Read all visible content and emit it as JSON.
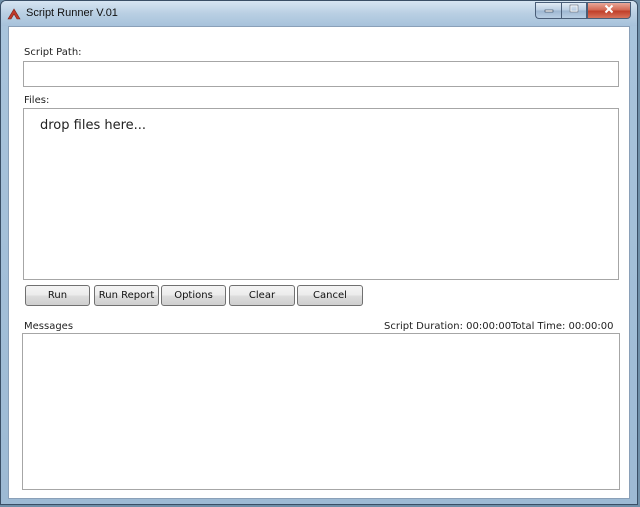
{
  "window": {
    "title": "Script Runner V.01",
    "icons": {
      "app": "app-logo-icon",
      "minimize": "minimize-icon",
      "maximize": "maximize-icon",
      "close": "close-icon"
    }
  },
  "script_path": {
    "label": "Script Path:",
    "value": "",
    "placeholder": ""
  },
  "files": {
    "label": "Files:",
    "drop_hint": "drop files here..."
  },
  "buttons": {
    "run": "Run",
    "run_report": "Run Report",
    "options": "Options",
    "clear": "Clear",
    "cancel": "Cancel"
  },
  "messages": {
    "label": "Messages",
    "script_duration": "Script Duration: 00:00:00",
    "total_time": "Total Time: 00:00:00",
    "content": ""
  },
  "colors": {
    "close_button": "#c1402b",
    "titlebar": "#b9cfe3",
    "app_icon": "#c0392b"
  }
}
